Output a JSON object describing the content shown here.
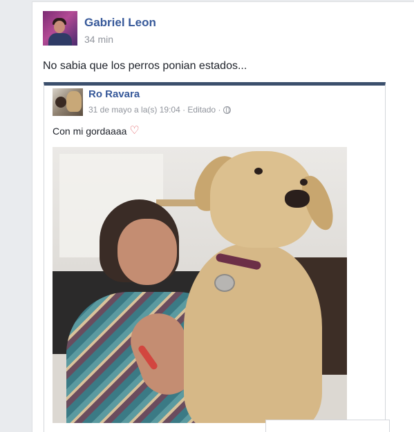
{
  "post": {
    "author": "Gabriel Leon",
    "time": "34 min",
    "text": "No sabia que los perros ponian estados..."
  },
  "shared_post": {
    "author": "Ro Ravara",
    "meta": "31 de mayo a la(s) 19:04 · Editado ·",
    "privacy_icon": "globe-icon",
    "text": "Con mi gordaaaa",
    "emoji_icon": "heart-icon",
    "emoji_glyph": "♡"
  },
  "colors": {
    "link_blue": "#365899",
    "meta_gray": "#90949c",
    "shared_top_border": "#3b4f6c"
  }
}
